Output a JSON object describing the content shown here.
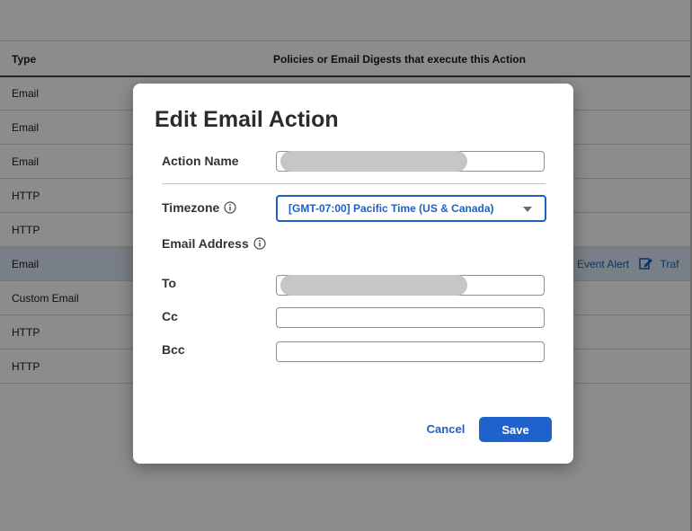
{
  "table": {
    "headers": {
      "type": "Type",
      "policies": "Policies or Email Digests that execute this Action"
    },
    "rows": [
      {
        "type": "Email"
      },
      {
        "type": "Email"
      },
      {
        "type": "Email"
      },
      {
        "type": "HTTP"
      },
      {
        "type": "HTTP"
      },
      {
        "type": "Email",
        "policies_text": "om Event Alert",
        "policies_text2": "Traf"
      },
      {
        "type": "Custom Email"
      },
      {
        "type": "HTTP"
      },
      {
        "type": "HTTP"
      }
    ]
  },
  "modal": {
    "title": "Edit Email Action",
    "action_name_label": "Action Name",
    "timezone_label": "Timezone",
    "timezone_value": "[GMT-07:00] Pacific Time (US & Canada)",
    "email_address_label": "Email Address",
    "to_label": "To",
    "cc_label": "Cc",
    "bcc_label": "Bcc",
    "cancel_label": "Cancel",
    "save_label": "Save"
  },
  "colors": {
    "accent": "#1f62cc",
    "overlay": "rgba(0,0,0,0.45)",
    "selected_row": "#dde7f5"
  }
}
